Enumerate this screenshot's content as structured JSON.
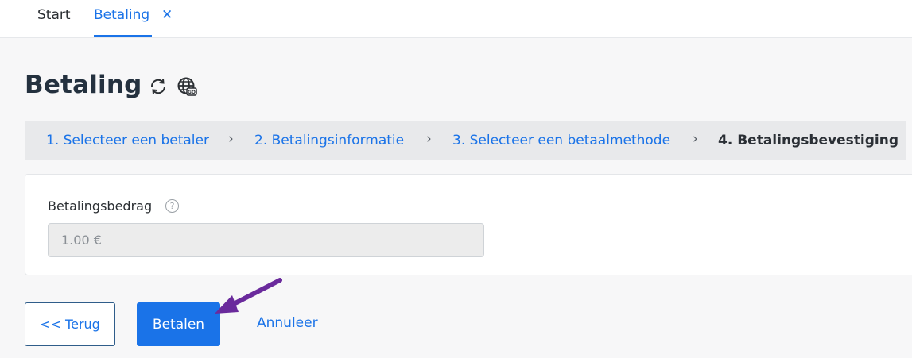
{
  "tabs": {
    "start_label": "Start",
    "active_label": "Betaling",
    "close_glyph": "✕"
  },
  "page": {
    "title": "Betaling",
    "icons": [
      "refresh-icon",
      "globe-icon"
    ]
  },
  "stepper": {
    "steps": [
      "1. Selecteer een betaler",
      "2. Betalingsinformatie",
      "3. Selecteer een betaalmethode",
      "4. Betalingsbevestiging"
    ],
    "separator": "›"
  },
  "form": {
    "amount_label": "Betalingsbedrag",
    "help_glyph": "?",
    "amount_value": "1.00 €"
  },
  "buttons": {
    "back_label": "<< Terug",
    "pay_label": "Betalen",
    "cancel_label": "Annuleer"
  },
  "colors": {
    "accent": "#1a73e8",
    "annotation_arrow": "#6a2a9c"
  }
}
